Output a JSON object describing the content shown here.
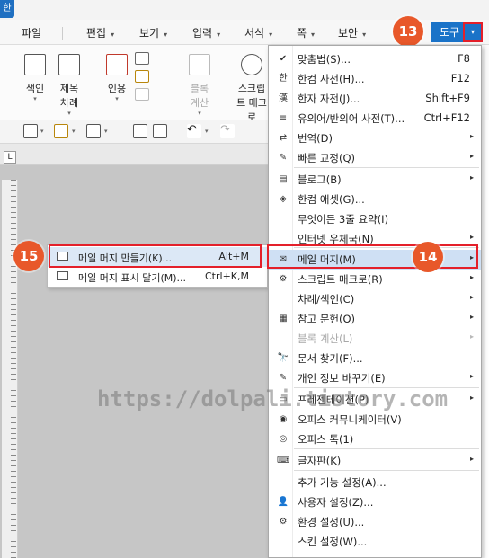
{
  "app": {
    "logo_char": "한"
  },
  "menubar": {
    "items": [
      {
        "label": "파일",
        "caret": ""
      },
      {
        "label": "편집",
        "caret": "▾"
      },
      {
        "label": "보기",
        "caret": "▾"
      },
      {
        "label": "입력",
        "caret": "▾"
      },
      {
        "label": "서식",
        "caret": "▾"
      },
      {
        "label": "쪽",
        "caret": "▾"
      },
      {
        "label": "보안",
        "caret": "▾"
      }
    ],
    "active_tab": "도구",
    "dropdown_glyph": "▾"
  },
  "ribbon": {
    "buttons": [
      {
        "label": "색인",
        "sub": "▾"
      },
      {
        "label": "제목 차례",
        "sub": "▾"
      },
      {
        "label": "인용",
        "sub": "▾"
      },
      {
        "label": "블록 계산",
        "sub": "▾"
      },
      {
        "label": "스크립트 매크로",
        "sub": ""
      }
    ]
  },
  "callouts": {
    "c13": "13",
    "c14": "14",
    "c15": "15"
  },
  "ruler": {
    "corner": "L"
  },
  "submenu": {
    "items": [
      {
        "label": "메일 머지 만들기(K)...",
        "shortcut": "Alt+M",
        "highlighted": true
      },
      {
        "label": "메일 머지 표시 달기(M)...",
        "shortcut": "Ctrl+K,M",
        "highlighted": false
      }
    ]
  },
  "menu": {
    "items": [
      {
        "icon": "✔",
        "label": "맞춤법(S)...",
        "shortcut": "F8",
        "sub": ""
      },
      {
        "icon": "한",
        "label": "한컴 사전(H)...",
        "shortcut": "F12",
        "sub": ""
      },
      {
        "icon": "漢",
        "label": "한자 자전(J)...",
        "shortcut": "Shift+F9",
        "sub": ""
      },
      {
        "icon": "≡",
        "label": "유의어/반의어 사전(T)...",
        "shortcut": "Ctrl+F12",
        "sub": ""
      },
      {
        "icon": "⇄",
        "label": "번역(D)",
        "shortcut": "",
        "sub": "▸"
      },
      {
        "icon": "✎",
        "label": "빠른 교정(Q)",
        "shortcut": "",
        "sub": "▸"
      },
      {
        "icon": "▤",
        "label": "블로그(B)",
        "shortcut": "",
        "sub": "▸"
      },
      {
        "icon": "◈",
        "label": "한컴 애셋(G)...",
        "shortcut": "",
        "sub": ""
      },
      {
        "icon": "",
        "label": "무엇이든 3줄 요약(I)",
        "shortcut": "",
        "sub": ""
      },
      {
        "icon": "",
        "label": "인터넷 우체국(N)",
        "shortcut": "",
        "sub": "▸"
      },
      {
        "icon": "✉",
        "label": "메일 머지(M)",
        "shortcut": "",
        "sub": "▸"
      },
      {
        "icon": "⚙",
        "label": "스크립트 매크로(R)",
        "shortcut": "",
        "sub": "▸"
      },
      {
        "icon": "",
        "label": "차례/색인(C)",
        "shortcut": "",
        "sub": "▸"
      },
      {
        "icon": "▦",
        "label": "참고 문헌(O)",
        "shortcut": "",
        "sub": "▸"
      },
      {
        "icon": "",
        "label": "블록 계산(L)",
        "shortcut": "",
        "sub": "▸"
      },
      {
        "icon": "🔭",
        "label": "문서 찾기(F)...",
        "shortcut": "",
        "sub": ""
      },
      {
        "icon": "✎",
        "label": "개인 정보 바꾸기(E)",
        "shortcut": "",
        "sub": "▸"
      },
      {
        "icon": "▭",
        "label": "프레젠테이션(P)",
        "shortcut": "",
        "sub": "▸"
      },
      {
        "icon": "◉",
        "label": "오피스 커뮤니케이터(V)",
        "shortcut": "",
        "sub": ""
      },
      {
        "icon": "◎",
        "label": "오피스 톡(1)",
        "shortcut": "",
        "sub": ""
      },
      {
        "icon": "⌨",
        "label": "글자판(K)",
        "shortcut": "",
        "sub": "▸"
      },
      {
        "icon": "",
        "label": "추가 기능 설정(A)...",
        "shortcut": "",
        "sub": ""
      },
      {
        "icon": "👤",
        "label": "사용자 설정(Z)...",
        "shortcut": "",
        "sub": ""
      },
      {
        "icon": "⚙",
        "label": "환경 설정(U)...",
        "shortcut": "",
        "sub": ""
      },
      {
        "icon": "",
        "label": "스킨 설정(W)...",
        "shortcut": "",
        "sub": ""
      }
    ]
  },
  "watermark": "https://dolpali.tistory.com"
}
